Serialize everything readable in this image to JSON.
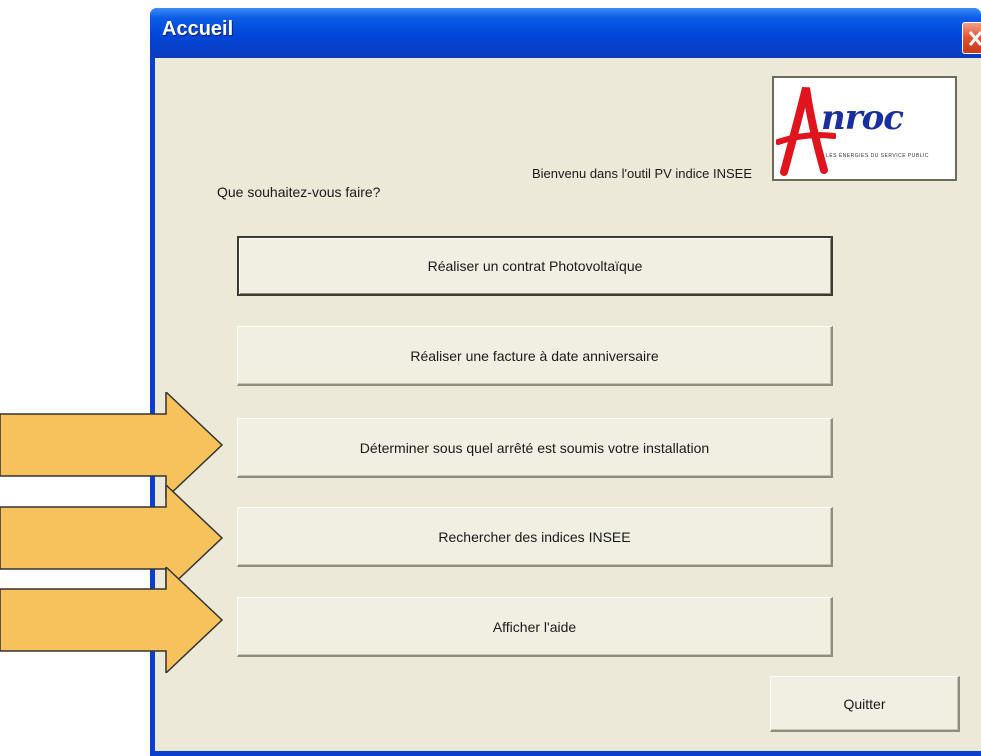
{
  "window": {
    "title": "Accueil"
  },
  "dialog": {
    "welcome_text": "Bienvenu dans l'outil PV indice INSEE",
    "question_text": "Que souhaitez-vous faire?"
  },
  "logo": {
    "brand": "nroc",
    "tagline": "LES ÉNERGIES DU SERVICE PUBLIC"
  },
  "buttons": {
    "contract": "Réaliser un contrat Photovoltaïque",
    "invoice": "Réaliser une facture à date anniversaire",
    "decree": "Déterminer sous quel arrêté est soumis votre installation",
    "indices": "Rechercher des indices INSEE",
    "help": "Afficher l'aide",
    "quit": "Quitter"
  },
  "colors": {
    "titlebar": "#0046d8",
    "dialog_bg": "#ece9d8",
    "arrow_fill": "#f7c25c",
    "logo_red": "#e0141e",
    "logo_blue": "#1a2f9e"
  }
}
